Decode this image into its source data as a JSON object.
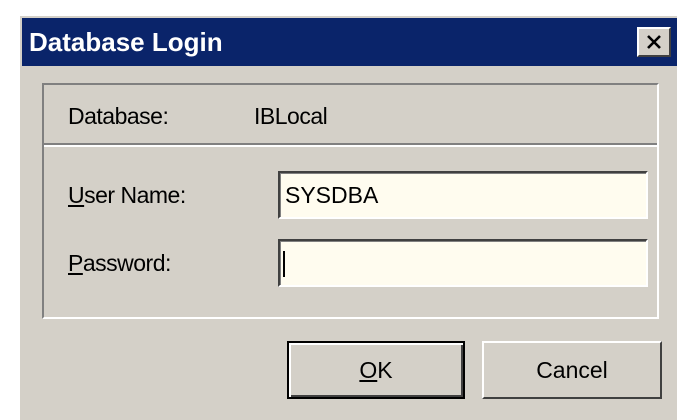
{
  "window": {
    "title": "Database Login"
  },
  "form": {
    "database_label": "Database:",
    "database_value": "IBLocal",
    "username_label_first": "U",
    "username_label_rest": "ser Name:",
    "username_value": "SYSDBA",
    "password_label_first": "P",
    "password_label_rest": "assword:",
    "password_value": ""
  },
  "buttons": {
    "ok_first": "O",
    "ok_rest": "K",
    "cancel": "Cancel"
  },
  "colors": {
    "titlebar": "#0a246a",
    "dialog_face": "#d4d0c8",
    "field_background": "#fffcef"
  },
  "icons": {
    "close": "close-icon"
  }
}
